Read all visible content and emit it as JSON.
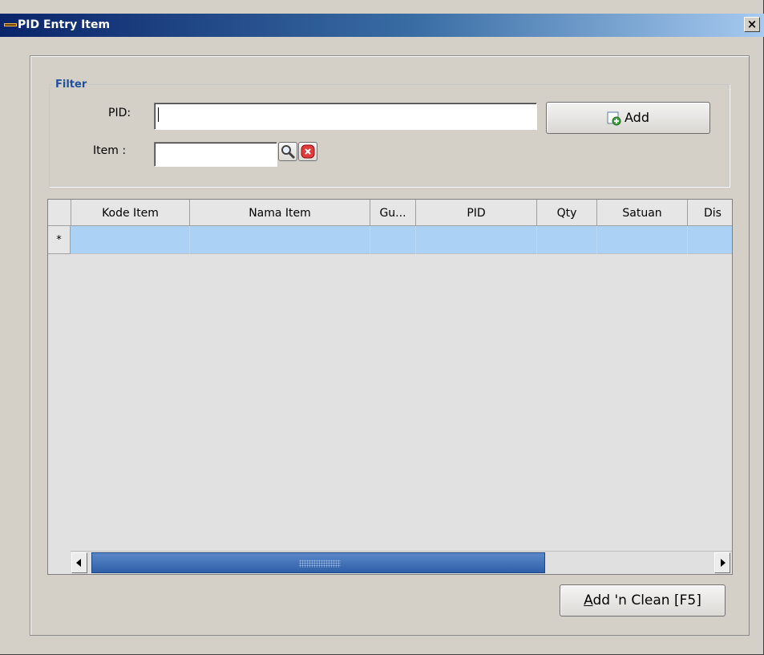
{
  "window": {
    "title": "PID Entry Item",
    "close_glyph": "×"
  },
  "filter": {
    "legend": "Filter",
    "pid_label": "PID:",
    "pid_value": "",
    "item_label": "Item :",
    "item_value": "",
    "add_label": "Add"
  },
  "grid": {
    "columns": [
      "Kode Item",
      "Nama Item",
      "Gu...",
      "PID",
      "Qty",
      "Satuan",
      "Dis"
    ],
    "new_row_marker": "*",
    "rows": [],
    "scroll_position_fraction": 0.45
  },
  "footer": {
    "clean_button_accel": "A",
    "clean_button_rest": "dd 'n Clean [F5]"
  },
  "colors": {
    "title_start": "#0a246a",
    "title_end": "#a6caf0",
    "selected_row": "#abd1f5",
    "filter_legend": "#1f4f9f"
  },
  "icons": {
    "app": "app-icon",
    "close": "close-icon",
    "add": "add-document-icon",
    "search": "magnifier-icon",
    "clear": "red-clear-icon"
  }
}
